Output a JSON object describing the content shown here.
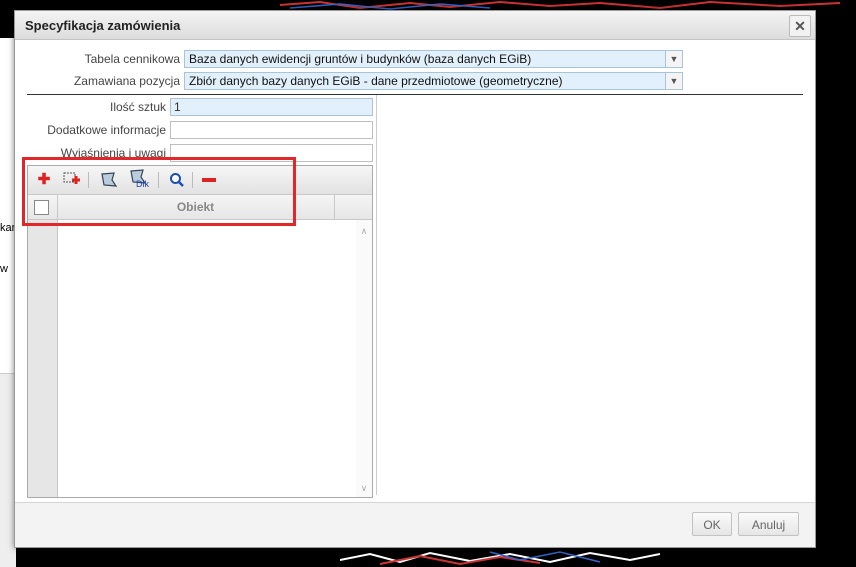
{
  "dialog": {
    "title": "Specyfikacja zamówienia",
    "close": "✕"
  },
  "form": {
    "tabela_label": "Tabela cennikowa",
    "tabela_value": "Baza danych ewidencji gruntów i budynków (baza danych EGiB)",
    "pozycja_label": "Zamawiana pozycja",
    "pozycja_value": "Zbiór danych bazy danych EGiB - dane przedmiotowe (geometryczne)",
    "ilosc_label": "Ilość sztuk",
    "ilosc_value": "1",
    "dodatkowe_label": "Dodatkowe informacje",
    "dodatkowe_value": "",
    "wyjasnienia_label": "Wyjaśnienia i uwagi",
    "wyjasnienia_value": ""
  },
  "grid": {
    "column_obiekt": "Obiekt",
    "toolbar_icons": [
      "add-icon",
      "add-from-map-icon",
      "select-polygon-icon",
      "select-polygon-dlk-icon",
      "zoom-icon",
      "remove-icon"
    ],
    "dlk_badge": "Dlk"
  },
  "footer": {
    "ok": "OK",
    "cancel": "Anuluj"
  },
  "background": {
    "frag_1": "kar",
    "frag_2": "w"
  },
  "colors": {
    "highlight": "#e3262a",
    "field_bg": "#e1f0fb"
  }
}
